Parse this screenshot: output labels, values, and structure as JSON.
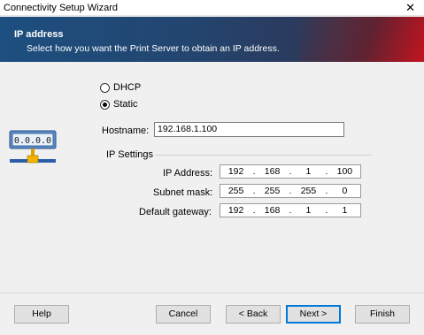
{
  "window": {
    "title": "Connectivity Setup Wizard",
    "close_glyph": "✕"
  },
  "banner": {
    "heading": "IP address",
    "subheading": "Select how you want the Print Server to obtain an IP address."
  },
  "mode": {
    "dhcp_label": "DHCP",
    "static_label": "Static",
    "selected": "Static"
  },
  "hostname": {
    "label": "Hostname:",
    "value": "192.168.1.100"
  },
  "ip_settings": {
    "group_label": "IP Settings",
    "ip_address": {
      "label": "IP Address:",
      "octets": [
        "192",
        "168",
        "1",
        "100"
      ]
    },
    "subnet_mask": {
      "label": "Subnet mask:",
      "octets": [
        "255",
        "255",
        "255",
        "0"
      ]
    },
    "default_gateway": {
      "label": "Default gateway:",
      "octets": [
        "192",
        "168",
        "1",
        "1"
      ]
    }
  },
  "icon": {
    "name": "network-printer-icon",
    "display_text": "0.0.0.0"
  },
  "buttons": {
    "help": "Help",
    "cancel": "Cancel",
    "back": "< Back",
    "next": "Next >",
    "finish": "Finish"
  },
  "colors": {
    "banner_blue": "#1d4f80",
    "banner_red": "#c8141e",
    "default_button_border": "#0078d7"
  }
}
